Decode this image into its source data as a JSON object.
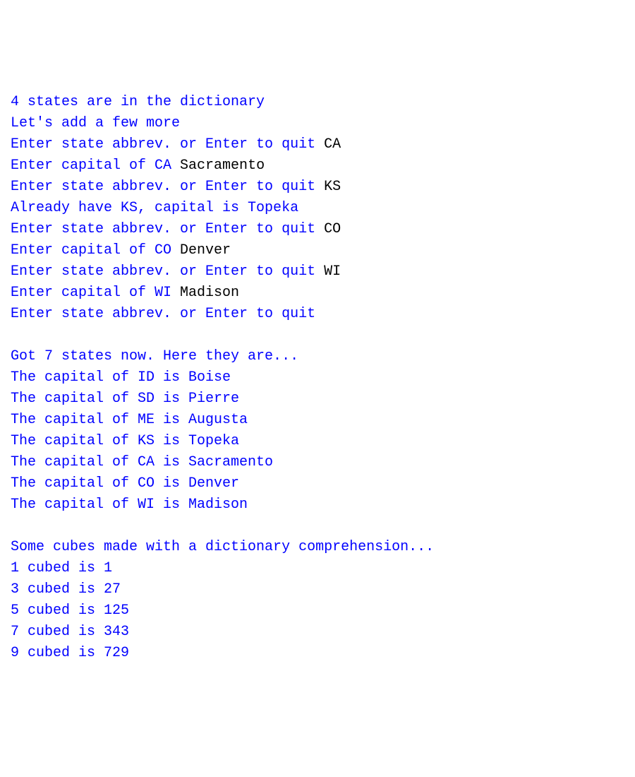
{
  "lines": [
    [
      {
        "t": "4 states are in the dictionary",
        "c": "out"
      }
    ],
    [
      {
        "t": "Let's add a few more",
        "c": "out"
      }
    ],
    [
      {
        "t": "Enter state abbrev. or Enter to quit ",
        "c": "out"
      },
      {
        "t": "CA",
        "c": "in"
      }
    ],
    [
      {
        "t": "Enter capital of CA ",
        "c": "out"
      },
      {
        "t": "Sacramento",
        "c": "in"
      }
    ],
    [
      {
        "t": "Enter state abbrev. or Enter to quit ",
        "c": "out"
      },
      {
        "t": "KS",
        "c": "in"
      }
    ],
    [
      {
        "t": "Already have KS, capital is Topeka",
        "c": "out"
      }
    ],
    [
      {
        "t": "Enter state abbrev. or Enter to quit ",
        "c": "out"
      },
      {
        "t": "CO",
        "c": "in"
      }
    ],
    [
      {
        "t": "Enter capital of CO ",
        "c": "out"
      },
      {
        "t": "Denver",
        "c": "in"
      }
    ],
    [
      {
        "t": "Enter state abbrev. or Enter to quit ",
        "c": "out"
      },
      {
        "t": "WI",
        "c": "in"
      }
    ],
    [
      {
        "t": "Enter capital of WI ",
        "c": "out"
      },
      {
        "t": "Madison",
        "c": "in"
      }
    ],
    [
      {
        "t": "Enter state abbrev. or Enter to quit",
        "c": "out"
      }
    ],
    [
      {
        "t": "",
        "c": "out"
      }
    ],
    [
      {
        "t": "Got 7 states now. Here they are...",
        "c": "out"
      }
    ],
    [
      {
        "t": "The capital of ID is Boise",
        "c": "out"
      }
    ],
    [
      {
        "t": "The capital of SD is Pierre",
        "c": "out"
      }
    ],
    [
      {
        "t": "The capital of ME is Augusta",
        "c": "out"
      }
    ],
    [
      {
        "t": "The capital of KS is Topeka",
        "c": "out"
      }
    ],
    [
      {
        "t": "The capital of CA is Sacramento",
        "c": "out"
      }
    ],
    [
      {
        "t": "The capital of CO is Denver",
        "c": "out"
      }
    ],
    [
      {
        "t": "The capital of WI is Madison",
        "c": "out"
      }
    ],
    [
      {
        "t": "",
        "c": "out"
      }
    ],
    [
      {
        "t": "Some cubes made with a dictionary comprehension...",
        "c": "out"
      }
    ],
    [
      {
        "t": "1 cubed is 1",
        "c": "out"
      }
    ],
    [
      {
        "t": "3 cubed is 27",
        "c": "out"
      }
    ],
    [
      {
        "t": "5 cubed is 125",
        "c": "out"
      }
    ],
    [
      {
        "t": "7 cubed is 343",
        "c": "out"
      }
    ],
    [
      {
        "t": "9 cubed is 729",
        "c": "out"
      }
    ]
  ]
}
